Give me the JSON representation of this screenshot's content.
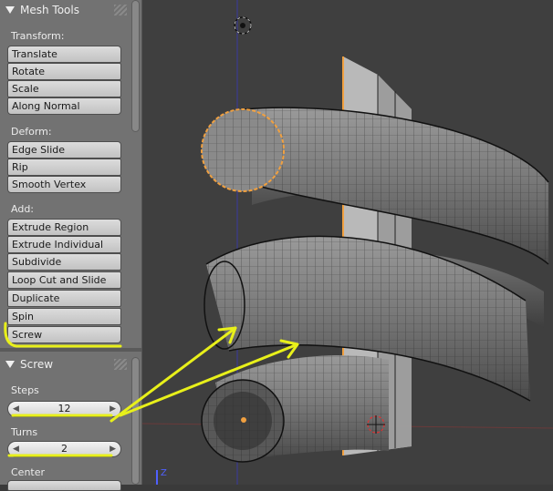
{
  "tool_panel": {
    "header": "Mesh Tools",
    "transform": {
      "label": "Transform:",
      "buttons": [
        "Translate",
        "Rotate",
        "Scale",
        "Along Normal"
      ]
    },
    "deform": {
      "label": "Deform:",
      "buttons": [
        "Edge Slide",
        "Rip",
        "Smooth Vertex"
      ]
    },
    "add": {
      "label": "Add:",
      "buttons": [
        "Extrude Region",
        "Extrude Individual",
        "Subdivide",
        "Loop Cut and Slide",
        "Duplicate",
        "Spin",
        "Screw"
      ]
    }
  },
  "operator_panel": {
    "header": "Screw",
    "steps_label": "Steps",
    "steps_value": "12",
    "turns_label": "Turns",
    "turns_value": "2",
    "center_label": "Center"
  },
  "colors": {
    "annotation": "#e8f01a",
    "selected_edge": "#f0a040",
    "panel_bg": "#727272",
    "viewport_bg": "#3f3f3f"
  },
  "viewport": {
    "axis_z": "Z",
    "icons": [
      "3d-cursor-icon",
      "3d-cursor-icon",
      "origin-dot-icon"
    ]
  }
}
